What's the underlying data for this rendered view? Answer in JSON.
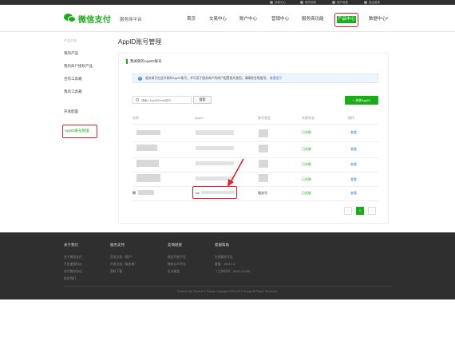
{
  "topbar": {
    "items": [
      "消息中心",
      "服务协助",
      "商户信息",
      "退出登录"
    ]
  },
  "header": {
    "logo_text": "微信支付",
    "platform": "服务商平台",
    "nav": [
      "首页",
      "交易中心",
      "账户中心",
      "营销中心",
      "服务商功能",
      "产品中心",
      "数据中心"
    ],
    "active_nav": "产品中心"
  },
  "sidebar": {
    "group_label": "产品大全",
    "items": [
      "我的产品",
      "我的商户授权产品",
      "合作工具箱",
      "我的工具箱"
    ],
    "dev_config": "开发配置",
    "active_item": "AppID账号管理"
  },
  "main": {
    "title": "AppID账号管理",
    "section_title": "我关联的AppID账号",
    "notice_text": "服务商可在此关联的AppID账号，并可用于服务商户的商户配置相关使用。请确保合规使用。",
    "notice_link": "查看指引",
    "search_placeholder": "请输入AppID/Email进行",
    "search_button": "搜索",
    "associate_button": "+ 关联AppID",
    "table": {
      "headers": [
        "名称",
        "AppID",
        "账号类型",
        "关联状态",
        "操作"
      ],
      "rows": [
        {
          "name": "",
          "appid": "",
          "type": "",
          "status": "已关联",
          "action": "查看"
        },
        {
          "name": "",
          "appid": "",
          "type": "",
          "status": "已关联",
          "action": "查看"
        },
        {
          "name": "",
          "appid": "",
          "type": "",
          "status": "已关联",
          "action": "查看"
        },
        {
          "name": "",
          "appid": "",
          "type": "",
          "status": "已关联",
          "action": "查看"
        },
        {
          "name": "腾",
          "appid": "wx",
          "type": "服务号",
          "status": "已关联",
          "action": "查看"
        }
      ]
    },
    "pagination": {
      "prev": "‹",
      "current": "1",
      "next": "›"
    }
  },
  "footer": {
    "columns": [
      {
        "title": "关于我们",
        "links": [
          "关于微信支付",
          "平台使用协议",
          "支付服务协议",
          "联系我们"
        ]
      },
      {
        "title": "服务支持",
        "links": [
          "开发文档（商户）",
          "开发文档（服务商）",
          "资料下载"
        ]
      },
      {
        "title": "友情链接",
        "links": [
          "微信开放平台",
          "微信公众平台",
          "企业微信"
        ]
      },
      {
        "title": "客服帮助",
        "links": [
          "在线服务专区",
          "客服：95017-3",
          "（工作时间：09:00-22:00）"
        ]
      }
    ],
    "copyright": "Powered By Tencent & Tenpay    Copyright 2005-2021 Tenpay All Rights Reserved."
  },
  "colors": {
    "accent": "#1aad19",
    "highlight": "#e0262a",
    "footer": "#2f2f2f",
    "link": "#3b78c8"
  }
}
